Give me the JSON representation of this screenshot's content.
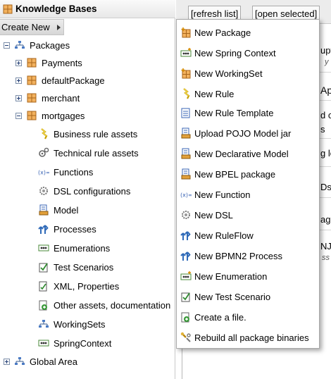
{
  "panel": {
    "title": "Knowledge Bases",
    "create_new": "Create New"
  },
  "tree": {
    "packages": "Packages",
    "payments": "Payments",
    "default_package": "defaultPackage",
    "merchant": "merchant",
    "mortgages": "mortgages",
    "children": [
      "Business rule assets",
      "Technical rule assets",
      "Functions",
      "DSL configurations",
      "Model",
      "Processes",
      "Enumerations",
      "Test Scenarios",
      "XML, Properties",
      "Other assets, documentation",
      "WorkingSets",
      "SpringContext"
    ],
    "global_area": "Global Area"
  },
  "right": {
    "refresh": "[refresh list]",
    "open_selected": "[open selected]",
    "fragments": [
      "upt",
      "y",
      "Ap",
      "d c",
      "s",
      "g le",
      "Ds",
      "age",
      "NJA",
      "ss"
    ]
  },
  "menu": {
    "items": [
      "New Package",
      "New Spring Context",
      "New WorkingSet",
      "New Rule",
      "New Rule Template",
      "Upload POJO Model jar",
      "New Declarative Model",
      "New BPEL package",
      "New Function",
      "New DSL",
      "New RuleFlow",
      "New BPMN2 Process",
      "New Enumeration",
      "New Test Scenario",
      "Create a file.",
      "Rebuild all package binaries"
    ]
  },
  "icons": {
    "header": "knowledge-base-icon",
    "package": "package-icon",
    "children": [
      "business-rule-icon",
      "technical-rule-icon",
      "function-icon",
      "dsl-icon",
      "model-icon",
      "process-icon",
      "enumeration-icon",
      "test-scenario-icon",
      "xml-icon",
      "other-assets-icon",
      "workingset-icon",
      "spring-context-icon"
    ]
  }
}
